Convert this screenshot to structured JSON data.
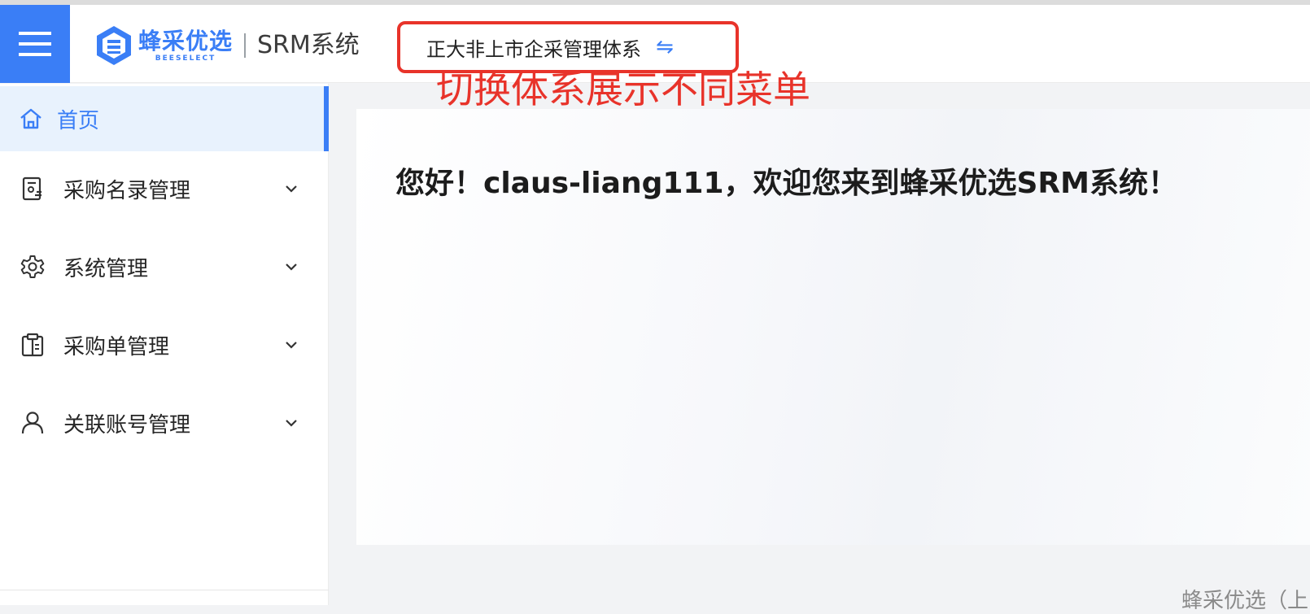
{
  "header": {
    "brand_cn": "蜂采优选",
    "brand_en": "BEESELECT",
    "system_name": "SRM系统",
    "current_system": "正大非上市企采管理体系",
    "switch_icon": "swap-arrows-icon"
  },
  "annotation": "切换体系展示不同菜单",
  "sidebar": {
    "items": [
      {
        "label": "首页",
        "icon": "home-icon",
        "active": true
      },
      {
        "label": "采购名录管理",
        "icon": "document-list-icon"
      },
      {
        "label": "系统管理",
        "icon": "gear-icon"
      },
      {
        "label": "采购单管理",
        "icon": "clipboard-icon"
      },
      {
        "label": "关联账号管理",
        "icon": "user-icon"
      }
    ]
  },
  "main": {
    "welcome": "您好！claus-liang111，欢迎您来到蜂采优选SRM系统！"
  },
  "footer": {
    "text": "蜂采优选（上"
  },
  "colors": {
    "accent": "#3a7ef6",
    "annotation": "#e8332a",
    "active_bg": "#e8f2fd"
  }
}
